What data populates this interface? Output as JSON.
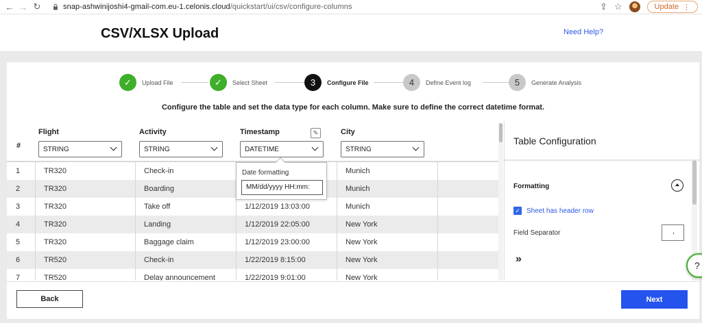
{
  "browser": {
    "url_host": "snap-ashwinijoshi4-gmail-com.eu-1.celonis.cloud",
    "url_path": "/quickstart/ui/csv/configure-columns",
    "update_label": "Update"
  },
  "header": {
    "title": "CSV/XLSX Upload",
    "help_link": "Need Help?"
  },
  "stepper": {
    "steps": [
      {
        "number": "1",
        "label": "Upload File",
        "state": "done"
      },
      {
        "number": "2",
        "label": "Select Sheet",
        "state": "done"
      },
      {
        "number": "3",
        "label": "Configure File",
        "state": "active"
      },
      {
        "number": "4",
        "label": "Define Event log",
        "state": "todo"
      },
      {
        "number": "5",
        "label": "Generate Analysis",
        "state": "todo"
      }
    ],
    "check_glyph": "✓"
  },
  "instructions": "Configure the table and set the data type for each column. Make sure to define the correct datetime format.",
  "table": {
    "index_header": "#",
    "columns": [
      {
        "name": "Flight",
        "type": "STRING"
      },
      {
        "name": "Activity",
        "type": "STRING"
      },
      {
        "name": "Timestamp",
        "type": "DATETIME"
      },
      {
        "name": "City",
        "type": "STRING"
      }
    ],
    "rows": [
      {
        "index": "1",
        "flight": "TR320",
        "activity": "Check-in",
        "timestamp": "",
        "city": "Munich"
      },
      {
        "index": "2",
        "flight": "TR320",
        "activity": "Boarding",
        "timestamp": "",
        "city": "Munich"
      },
      {
        "index": "3",
        "flight": "TR320",
        "activity": "Take off",
        "timestamp": "1/12/2019 13:03:00",
        "city": "Munich"
      },
      {
        "index": "4",
        "flight": "TR320",
        "activity": "Landing",
        "timestamp": "1/12/2019 22:05:00",
        "city": "New York"
      },
      {
        "index": "5",
        "flight": "TR320",
        "activity": "Baggage claim",
        "timestamp": "1/12/2019 23:00:00",
        "city": "New York"
      },
      {
        "index": "6",
        "flight": "TR520",
        "activity": "Check-in",
        "timestamp": "1/22/2019 8:15:00",
        "city": "New York"
      },
      {
        "index": "7",
        "flight": "TR520",
        "activity": "Delay announcement",
        "timestamp": "1/22/2019 9:01:00",
        "city": "New York"
      }
    ],
    "date_popup": {
      "label": "Date formatting",
      "value": "MM/dd/yyyy HH:mm:"
    }
  },
  "side_panel": {
    "title": "Table Configuration",
    "section": "Formatting",
    "header_row_label": "Sheet has header row",
    "header_row_checked": true,
    "field_separator_label": "Field Separator",
    "field_separator_value": ",",
    "expand_glyph": "»"
  },
  "footer": {
    "back_label": "Back",
    "next_label": "Next"
  },
  "float_help_glyph": "?",
  "colors": {
    "accent_blue": "#2453ee",
    "step_done_green": "#3fae2a",
    "step_active": "#111111",
    "step_todo": "#c8c8c8"
  }
}
